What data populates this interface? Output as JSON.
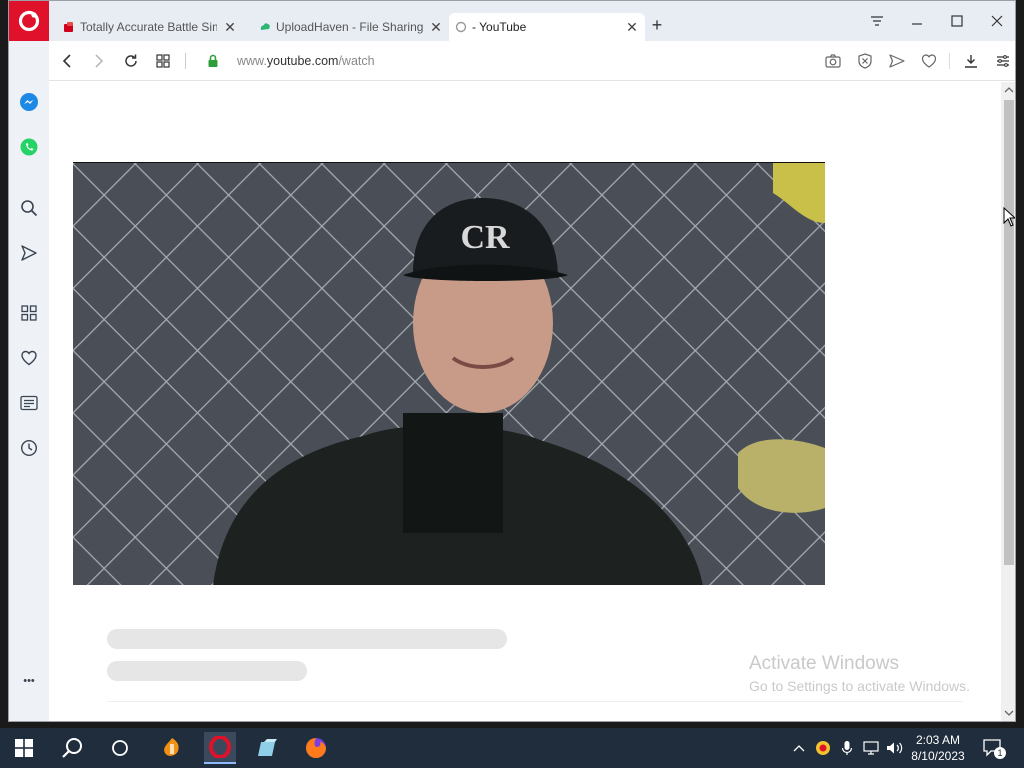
{
  "tabs": [
    {
      "title": "Totally Accurate Battle Sim",
      "close": "✕"
    },
    {
      "title": "UploadHaven - File Sharing",
      "close": "✕"
    },
    {
      "title": "- YouTube",
      "close": "✕"
    }
  ],
  "new_tab_label": "+",
  "address": {
    "domain": "www.youtube.com",
    "path": "/watch"
  },
  "activation": {
    "title": "Activate Windows",
    "subtitle": "Go to Settings to activate Windows."
  },
  "clock": {
    "time": "2:03 AM",
    "date": "8/10/2023"
  },
  "notification_count": "1",
  "sidebar_more": "•••",
  "colors": {
    "opera_red": "#e0112b",
    "taskbar": "#1f2d3d",
    "tabstrip": "#e8edf4"
  },
  "icons": {
    "sidebar": [
      "messenger-icon",
      "whatsapp-icon",
      "search-icon",
      "send-icon",
      "speed-dial-icon",
      "heart-icon",
      "news-icon",
      "history-icon",
      "more-icon"
    ],
    "toolbar": [
      "camera-icon",
      "adblock-icon",
      "send-icon",
      "heart-icon",
      "download-icon",
      "easy-setup-icon"
    ]
  }
}
